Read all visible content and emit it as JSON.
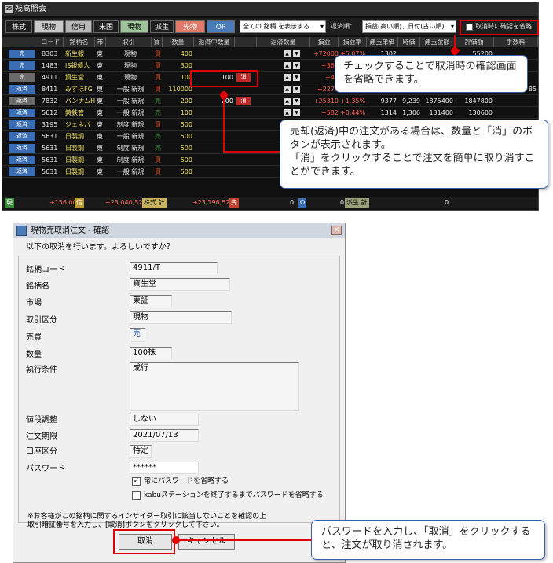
{
  "window": {
    "title": "残高照会"
  },
  "toolbar": {
    "tabs": [
      {
        "label": "株式",
        "bg": "#1e1e1e",
        "fg": "#ffffff"
      },
      {
        "label": "現物",
        "bg": "#c9c9c9",
        "fg": "#000000"
      },
      {
        "label": "信用",
        "bg": "#b7b7b7",
        "fg": "#000000"
      },
      {
        "label": "米国",
        "bg": "#1e1e1e",
        "fg": "#ffffff"
      },
      {
        "label": "現物",
        "bg": "#9ec49a",
        "fg": "#000000"
      },
      {
        "label": "派生",
        "bg": "#1e1e1e",
        "fg": "#ffffff"
      },
      {
        "label": "先物",
        "bg": "#e07b6b",
        "fg": "#ffffff"
      },
      {
        "label": "OP",
        "bg": "#4a7ab8",
        "fg": "#ffffff"
      }
    ],
    "filter": "全ての 銘柄 を表示する",
    "order_label": "返済順：",
    "order_value": "損益(高い順)、日付(古い順)",
    "skip_confirm_label": "取消時に確認を省略"
  },
  "columns": [
    "コード",
    "銘柄名",
    "市",
    "取引",
    "買",
    "数量",
    "返済中数量",
    "",
    "返済数量",
    "損益",
    "損益率",
    "建玉単価",
    "時価",
    "建玉金額",
    "評価額",
    "手数料"
  ],
  "rows": [
    {
      "btn": "売",
      "btn_color": "#3a6db3",
      "code": "8303",
      "name": "新生銀",
      "market": "東",
      "trade": "現物",
      "side": "買",
      "side_color": "#e05030",
      "qty": "400",
      "pend": "",
      "cancel": "",
      "pl": "+72000",
      "rate": "+5.07%",
      "unit": "1302",
      "price": "",
      "amt": "",
      "val": "55200",
      "fee": ""
    },
    {
      "btn": "売",
      "btn_color": "#3a6db3",
      "code": "1483",
      "name": "iS銀債人",
      "market": "東",
      "trade": "現物",
      "side": "買",
      "side_color": "#e05030",
      "qty": "300",
      "pend": "",
      "cancel": "",
      "pl": "+365",
      "rate": "",
      "unit": "",
      "price": "",
      "amt": "",
      "val": "",
      "fee": ""
    },
    {
      "btn": "売",
      "btn_color": "#6a6a6a",
      "code": "4911",
      "name": "資生堂",
      "market": "東",
      "trade": "現物",
      "side": "買",
      "side_color": "#e05030",
      "qty": "100",
      "pend": "100",
      "cancel": "消",
      "pl": "+47",
      "rate": "",
      "unit": "",
      "price": "",
      "amt": "",
      "val": "",
      "fee": ""
    },
    {
      "btn": "返済",
      "btn_color": "#3a6db3",
      "code": "8411",
      "name": "みずほFG",
      "market": "東",
      "trade": "一般 新規",
      "side": "買",
      "side_color": "#e05030",
      "qty": "110000",
      "pend": "",
      "cancel": "",
      "pl": "+2273",
      "rate": "",
      "unit": "",
      "price": "",
      "amt": "",
      "val": "",
      "fee": "85"
    },
    {
      "btn": "返済",
      "btn_color": "#6a6a6a",
      "code": "7832",
      "name": "バンナムH",
      "market": "東",
      "trade": "一般 新規",
      "side": "売",
      "side_color": "#3a8a3a",
      "qty": "200",
      "pend": "200",
      "cancel": "消",
      "pl": "+25310",
      "rate": "+1.35%",
      "unit": "9377",
      "price": "9,239",
      "amt": "1875400",
      "val": "1847800",
      "fee": ""
    },
    {
      "btn": "返済",
      "btn_color": "#3a6db3",
      "code": "5612",
      "name": "鋳鉄管",
      "market": "東",
      "trade": "一般 新規",
      "side": "売",
      "side_color": "#3a8a3a",
      "qty": "100",
      "pend": "",
      "cancel": "",
      "pl": "+582",
      "rate": "+0.44%",
      "unit": "1314",
      "price": "1,306",
      "amt": "131400",
      "val": "130600",
      "fee": ""
    },
    {
      "btn": "返済",
      "btn_color": "#3a6db3",
      "code": "3195",
      "name": "ジェネパ",
      "market": "東",
      "trade": "制度 新規",
      "side": "買",
      "side_color": "#e05030",
      "qty": "500",
      "pend": "",
      "cancel": "",
      "pl": "",
      "rate": "",
      "unit": "",
      "price": "",
      "amt": "",
      "val": "",
      "fee": ""
    },
    {
      "btn": "返済",
      "btn_color": "#3a6db3",
      "code": "5631",
      "name": "日製鋼",
      "market": "東",
      "trade": "一般 新規",
      "side": "売",
      "side_color": "#3a8a3a",
      "qty": "500",
      "pend": "",
      "cancel": "",
      "pl": "",
      "rate": "",
      "unit": "",
      "price": "",
      "amt": "",
      "val": "",
      "fee": ""
    },
    {
      "btn": "返済",
      "btn_color": "#3a6db3",
      "code": "5631",
      "name": "日製鋼",
      "market": "東",
      "trade": "制度 新規",
      "side": "売",
      "side_color": "#3a8a3a",
      "qty": "500",
      "pend": "",
      "cancel": "",
      "pl": "",
      "rate": "",
      "unit": "",
      "price": "",
      "amt": "",
      "val": "",
      "fee": ""
    },
    {
      "btn": "返済",
      "btn_color": "#3a6db3",
      "code": "5631",
      "name": "日製鋼",
      "market": "東",
      "trade": "制度 新規",
      "side": "買",
      "side_color": "#e05030",
      "qty": "500",
      "pend": "",
      "cancel": "",
      "pl": "",
      "rate": "",
      "unit": "",
      "price": "",
      "amt": "",
      "val": "",
      "fee": ""
    },
    {
      "btn": "返済",
      "btn_color": "#3a6db3",
      "code": "5631",
      "name": "日製鋼",
      "market": "東",
      "trade": "一般 新規",
      "side": "買",
      "side_color": "#e05030",
      "qty": "500",
      "pend": "",
      "cancel": "",
      "pl": "",
      "rate": "",
      "unit": "",
      "price": "",
      "amt": "",
      "val": "",
      "fee": ""
    }
  ],
  "statusbar": {
    "genbutsu": "現",
    "pl1": "+156,000",
    "shin": "信",
    "pl2": "+23,040,526",
    "kabu_total": "株式 計",
    "pl3": "+23,196,526",
    "sen": "先",
    "v1": "0",
    "o": "O",
    "v2": "0",
    "hasei_total": "派生 計",
    "v3": "0"
  },
  "callouts": {
    "c1": "チェックすることで取消時の確認画面を省略できます。",
    "c2": "売却(返済)中の注文がある場合は、数量と「消」のボタンが表示されます。\n「消」をクリックすることで注文を簡単に取り消すことができます。",
    "c3": "パスワードを入力し、「取消」をクリックすると、注文が取り消されます。"
  },
  "dialog": {
    "title": "現物売取消注文 - 確認",
    "prompt": "以下の取消を行います。よろしいですか？",
    "labels": {
      "code": "銘柄コード",
      "name": "銘柄名",
      "market": "市場",
      "trade_type": "取引区分",
      "side": "売買",
      "qty": "数量",
      "condition": "執行条件",
      "price_adj": "値段調整",
      "expiry": "注文期限",
      "account": "口座区分",
      "password": "パスワード"
    },
    "values": {
      "code": "4911/T",
      "name": "資生堂",
      "market": "東証",
      "trade_type": "現物",
      "side": "売",
      "qty": "100株",
      "condition": "成行",
      "price_adj": "しない",
      "expiry": "2021/07/13",
      "account": "特定",
      "password": "******"
    },
    "check1": "常にパスワードを省略する",
    "check2": "kabuステーションを終了するまでパスワードを省略する",
    "note": "※お客様がこの銘柄に関するインサイダー取引に該当しないことを確認の上\n取引暗証番号を入力し、[取消]ボタンをクリックして下さい。",
    "ok_label": "取消",
    "cancel_label": "キャンセル"
  }
}
